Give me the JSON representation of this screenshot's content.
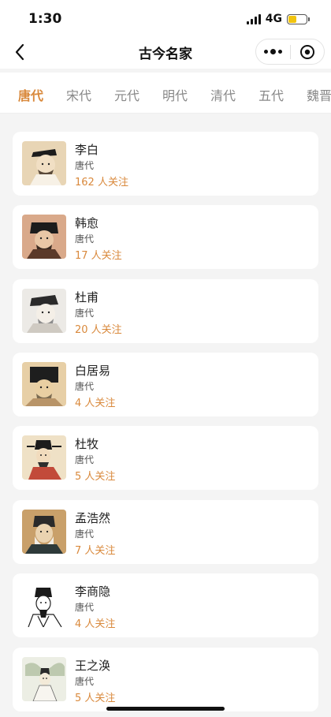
{
  "status_bar": {
    "time": "1:30",
    "network": "4G"
  },
  "nav": {
    "title": "古今名家"
  },
  "tabs": [
    {
      "label": "唐代",
      "active": true
    },
    {
      "label": "宋代",
      "active": false
    },
    {
      "label": "元代",
      "active": false
    },
    {
      "label": "明代",
      "active": false
    },
    {
      "label": "清代",
      "active": false
    },
    {
      "label": "五代",
      "active": false
    },
    {
      "label": "魏晋",
      "active": false
    }
  ],
  "poets": [
    {
      "name": "李白",
      "dynasty": "唐代",
      "followers": "162 人关注"
    },
    {
      "name": "韩愈",
      "dynasty": "唐代",
      "followers": "17 人关注"
    },
    {
      "name": "杜甫",
      "dynasty": "唐代",
      "followers": "20 人关注"
    },
    {
      "name": "白居易",
      "dynasty": "唐代",
      "followers": "4 人关注"
    },
    {
      "name": "杜牧",
      "dynasty": "唐代",
      "followers": "5 人关注"
    },
    {
      "name": "孟浩然",
      "dynasty": "唐代",
      "followers": "7 人关注"
    },
    {
      "name": "李商隐",
      "dynasty": "唐代",
      "followers": "4 人关注"
    },
    {
      "name": "王之涣",
      "dynasty": "唐代",
      "followers": "5 人关注"
    }
  ],
  "colors": {
    "accent": "#d9893c",
    "background": "#f4f4f4"
  }
}
